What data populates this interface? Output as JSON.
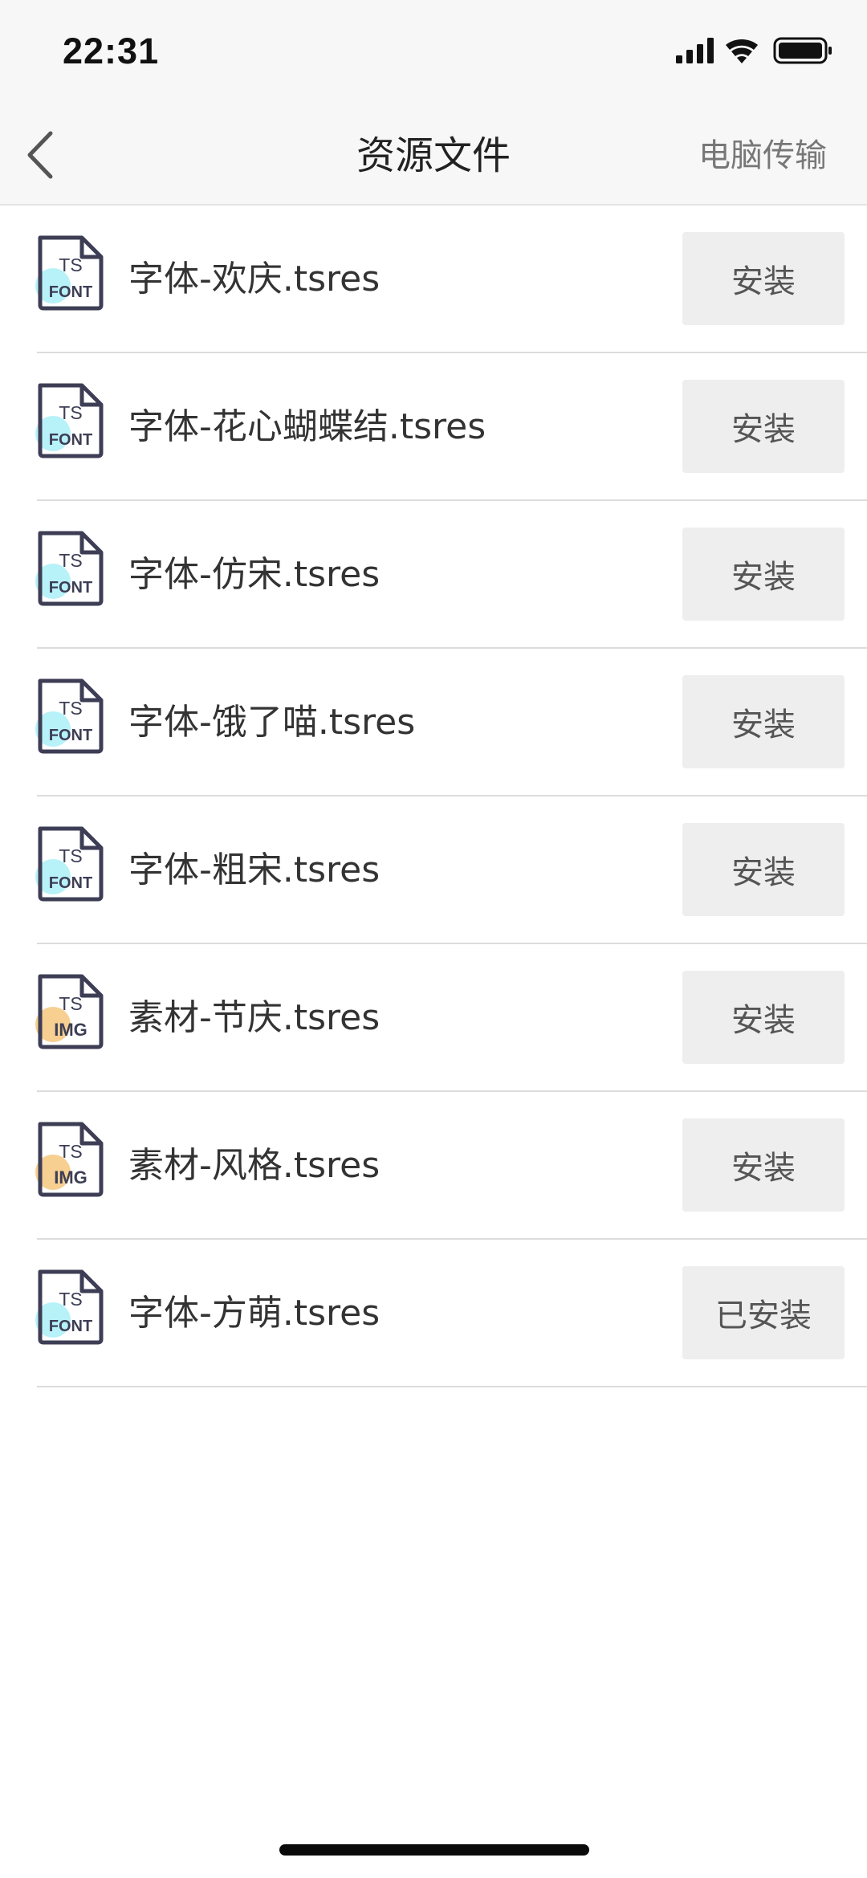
{
  "status_bar": {
    "time": "22:31",
    "icons": [
      "signal-icon",
      "wifi-icon",
      "battery-icon"
    ]
  },
  "nav": {
    "back_icon": "chevron-left-icon",
    "title": "资源文件",
    "action_label": "电脑传输"
  },
  "files": [
    {
      "name": "字体-欢庆.tsres",
      "type": "font",
      "badge_top": "TS",
      "badge_bottom": "FONT",
      "button": "安装"
    },
    {
      "name": "字体-花心蝴蝶结.tsres",
      "type": "font",
      "badge_top": "TS",
      "badge_bottom": "FONT",
      "button": "安装"
    },
    {
      "name": "字体-仿宋.tsres",
      "type": "font",
      "badge_top": "TS",
      "badge_bottom": "FONT",
      "button": "安装"
    },
    {
      "name": "字体-饿了喵.tsres",
      "type": "font",
      "badge_top": "TS",
      "badge_bottom": "FONT",
      "button": "安装"
    },
    {
      "name": "字体-粗宋.tsres",
      "type": "font",
      "badge_top": "TS",
      "badge_bottom": "FONT",
      "button": "安装"
    },
    {
      "name": "素材-节庆.tsres",
      "type": "image",
      "badge_top": "TS",
      "badge_bottom": "IMG",
      "button": "安装"
    },
    {
      "name": "素材-风格.tsres",
      "type": "image",
      "badge_top": "TS",
      "badge_bottom": "IMG",
      "button": "安装"
    },
    {
      "name": "字体-方萌.tsres",
      "type": "font",
      "badge_top": "TS",
      "badge_bottom": "FONT",
      "button": "已安装"
    }
  ],
  "colors": {
    "font_accent": "#aaf0f7",
    "image_accent": "#f5c77e",
    "icon_stroke": "#3d3e55"
  }
}
